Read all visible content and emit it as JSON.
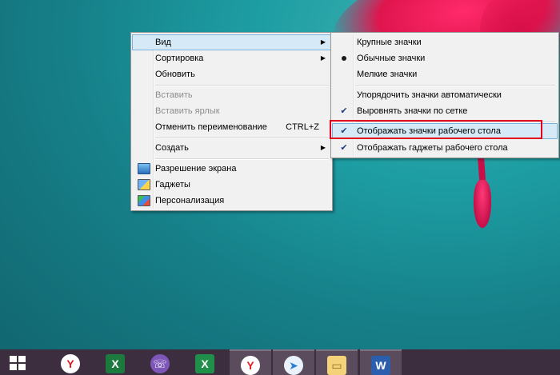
{
  "context_menu": {
    "items": [
      {
        "label": "Вид",
        "submenu": true,
        "selected": true
      },
      {
        "label": "Сортировка",
        "submenu": true
      },
      {
        "label": "Обновить"
      },
      {
        "label": "Вставить",
        "disabled": true
      },
      {
        "label": "Вставить ярлык",
        "disabled": true
      },
      {
        "label": "Отменить переименование",
        "shortcut": "CTRL+Z"
      },
      {
        "label": "Создать",
        "submenu": true
      },
      {
        "label": "Разрешение экрана",
        "icon": "monitor-icon"
      },
      {
        "label": "Гаджеты",
        "icon": "gadgets-icon"
      },
      {
        "label": "Персонализация",
        "icon": "personalization-icon"
      }
    ]
  },
  "view_submenu": {
    "items": [
      {
        "label": "Крупные значки"
      },
      {
        "label": "Обычные значки",
        "marker": "dot"
      },
      {
        "label": "Мелкие значки"
      },
      {
        "label": "Упорядочить значки автоматически"
      },
      {
        "label": "Выровнять значки по сетке",
        "marker": "check"
      },
      {
        "label": "Отображать значки рабочего стола",
        "marker": "check",
        "selected": true,
        "highlighted": true
      },
      {
        "label": "Отображать гаджеты  рабочего стола",
        "marker": "check"
      }
    ]
  },
  "taskbar": {
    "buttons": [
      {
        "name": "start-button",
        "icon": "windows-logo-icon"
      },
      {
        "name": "yandex-browser",
        "icon": "yandex-icon",
        "glyph": "Y"
      },
      {
        "name": "excel",
        "icon": "excel-icon",
        "glyph": "X"
      },
      {
        "name": "viber",
        "icon": "viber-icon",
        "glyph": "☏"
      },
      {
        "name": "excel-2",
        "icon": "excel-icon",
        "glyph": "X"
      },
      {
        "name": "yandex-browser-2",
        "icon": "yandex-icon",
        "glyph": "Y",
        "active": true
      },
      {
        "name": "messenger",
        "icon": "paper-plane-icon",
        "glyph": "➤",
        "active": true
      },
      {
        "name": "file-explorer",
        "icon": "folder-icon",
        "glyph": "▭",
        "active": true
      },
      {
        "name": "word",
        "icon": "word-icon",
        "glyph": "W",
        "active": true
      }
    ]
  },
  "colors": {
    "highlight_border": "#e3001b",
    "selected_item": "#d6e9f7",
    "taskbar": "#3c2d3f"
  }
}
